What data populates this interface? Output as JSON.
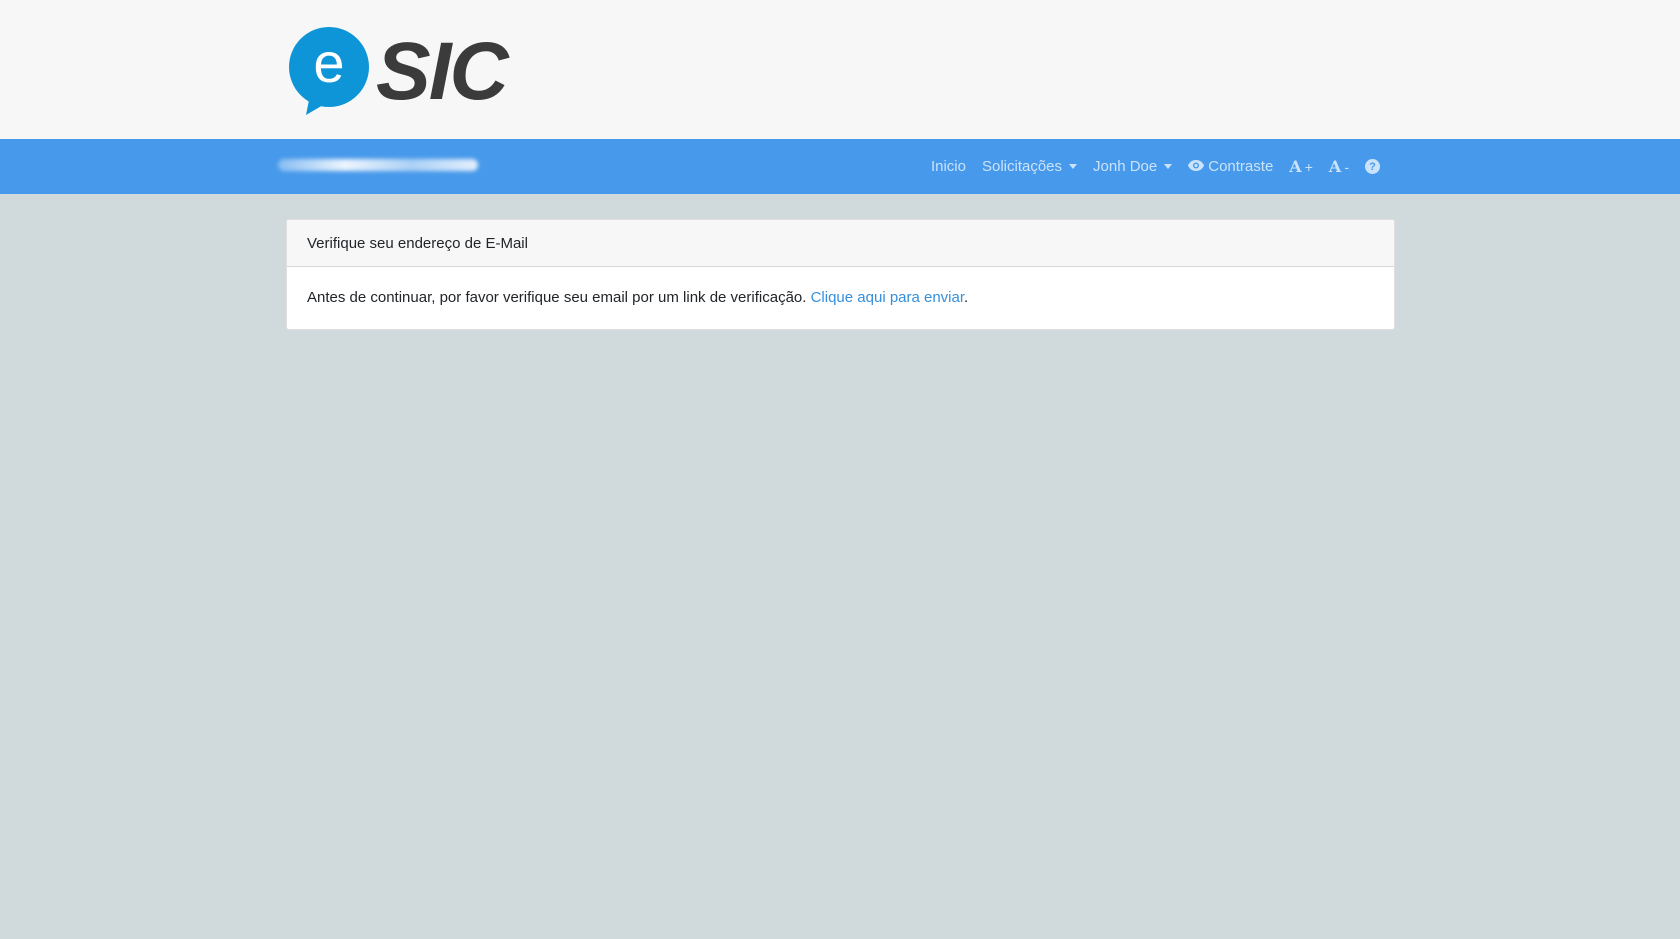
{
  "logo": {
    "letter": "e",
    "text": "SIC",
    "bubble_color": "#0e95d8",
    "text_color": "#3b3b3b"
  },
  "navbar": {
    "background": "#4799eb",
    "items": {
      "home": "Inicio",
      "requests": "Solicitações",
      "user": "Jonh Doe",
      "contrast": "Contraste",
      "font_increase_letter": "A",
      "font_increase_sign": "+",
      "font_decrease_letter": "A",
      "font_decrease_sign": "-",
      "help_symbol": "?"
    },
    "icons": [
      "eye-icon",
      "font-increase-icon",
      "font-decrease-icon",
      "question-circle-icon",
      "caret-down-icon"
    ]
  },
  "card": {
    "header": "Verifique seu endereço de E-Mail",
    "body_text": "Antes de continuar, por favor verifique seu email por um link de verificação. ",
    "link_text": "Clique aqui para enviar",
    "trailing": "."
  },
  "colors": {
    "page_background": "#d0d9dc",
    "header_background": "#f7f7f7",
    "link": "#3490dc"
  }
}
